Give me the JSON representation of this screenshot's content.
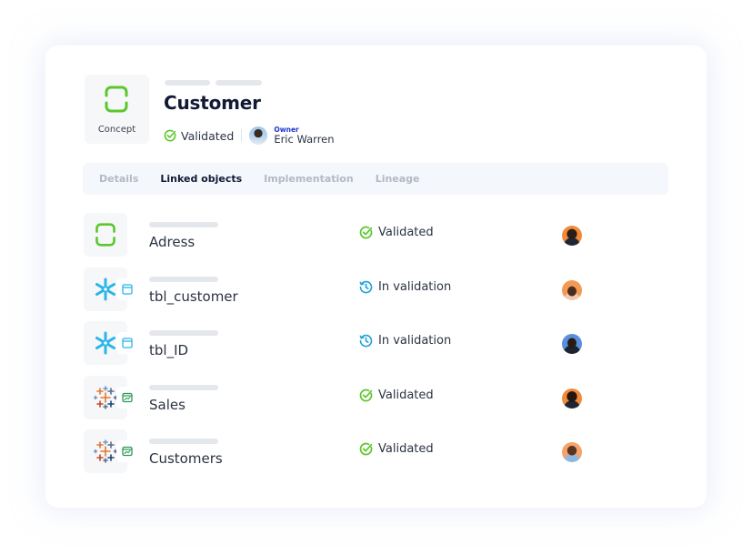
{
  "header": {
    "type_label": "Concept",
    "type_icon": "concept-bracket-icon",
    "title": "Customer",
    "status": {
      "label": "Validated",
      "icon": "check-circle-icon"
    },
    "owner": {
      "label": "Owner",
      "name": "Eric Warren"
    }
  },
  "tabs": [
    {
      "label": "Details",
      "active": false
    },
    {
      "label": "Linked objects",
      "active": true
    },
    {
      "label": "Implementation",
      "active": false
    },
    {
      "label": "Lineage",
      "active": false
    }
  ],
  "linked_objects": [
    {
      "name": "Adress",
      "source_icon": "concept-bracket-icon",
      "badge_icon": null,
      "status": "Validated",
      "status_icon": "check-circle-icon"
    },
    {
      "name": "tbl_customer",
      "source_icon": "snowflake-icon",
      "badge_icon": "table-icon",
      "status": "In validation",
      "status_icon": "history-clock-icon"
    },
    {
      "name": "tbl_ID",
      "source_icon": "snowflake-icon",
      "badge_icon": "table-icon",
      "status": "In validation",
      "status_icon": "history-clock-icon"
    },
    {
      "name": "Sales",
      "source_icon": "tableau-icon",
      "badge_icon": "dashboard-chart-icon",
      "status": "Validated",
      "status_icon": "check-circle-icon"
    },
    {
      "name": "Customers",
      "source_icon": "tableau-icon",
      "badge_icon": "dashboard-chart-icon",
      "status": "Validated",
      "status_icon": "check-circle-icon"
    }
  ],
  "colors": {
    "validated": "#5ac72a",
    "in_validation": "#1ea2d8",
    "snowflake": "#29b5e8",
    "owner_label": "#1b36c9",
    "title": "#111a33"
  }
}
